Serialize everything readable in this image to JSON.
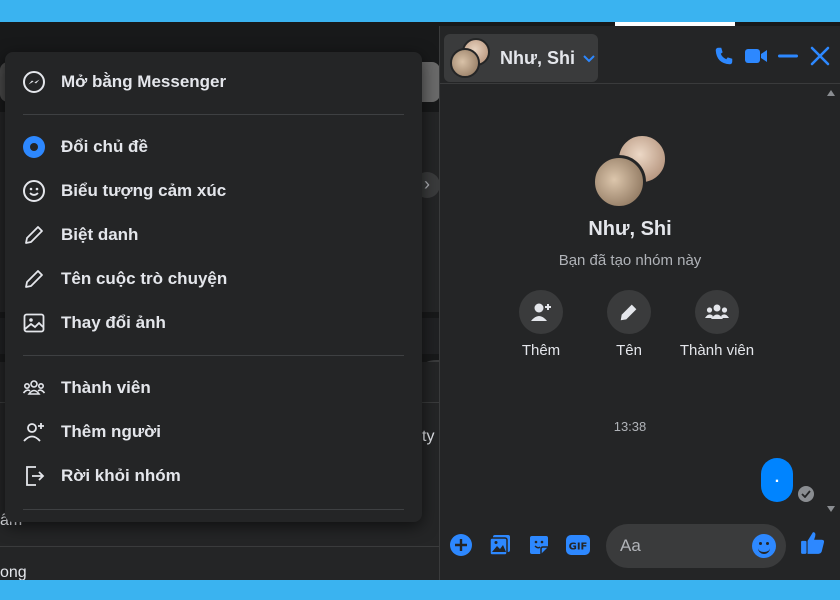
{
  "menu": {
    "items_top": [
      {
        "label": "Mở bằng Messenger",
        "icon": "messenger-icon"
      }
    ],
    "items_middle": [
      {
        "label": "Đổi chủ đề",
        "icon": "theme-icon"
      },
      {
        "label": "Biểu tượng cảm xúc",
        "icon": "emoji-icon"
      },
      {
        "label": "Biệt danh",
        "icon": "pencil-icon"
      },
      {
        "label": "Tên cuộc trò chuyện",
        "icon": "pencil-icon"
      },
      {
        "label": "Thay đổi ảnh",
        "icon": "image-icon"
      }
    ],
    "items_bottom": [
      {
        "label": "Thành viên",
        "icon": "members-icon"
      },
      {
        "label": "Thêm người",
        "icon": "add-person-icon"
      },
      {
        "label": "Rời khỏi nhóm",
        "icon": "leave-icon"
      }
    ]
  },
  "feed": {
    "partial_text_1": "ty",
    "partial_text_2": "ấm",
    "partial_text_3": "ong"
  },
  "chat": {
    "header_name": "Như, Shi",
    "group_name": "Như, Shi",
    "group_subtitle": "Bạn đã tạo nhóm này",
    "actions": [
      {
        "label": "Thêm",
        "icon": "add-person-icon"
      },
      {
        "label": "Tên",
        "icon": "pencil-icon"
      },
      {
        "label": "Thành viên",
        "icon": "members-icon"
      }
    ],
    "timestamp": "13:38",
    "message": ".",
    "composer": {
      "placeholder": "Aa"
    }
  },
  "colors": {
    "frame": "#3ab3f0",
    "accent": "#2d88ff",
    "bubble": "#0084ff",
    "panel": "#242526",
    "text": "#e4e6eb"
  }
}
